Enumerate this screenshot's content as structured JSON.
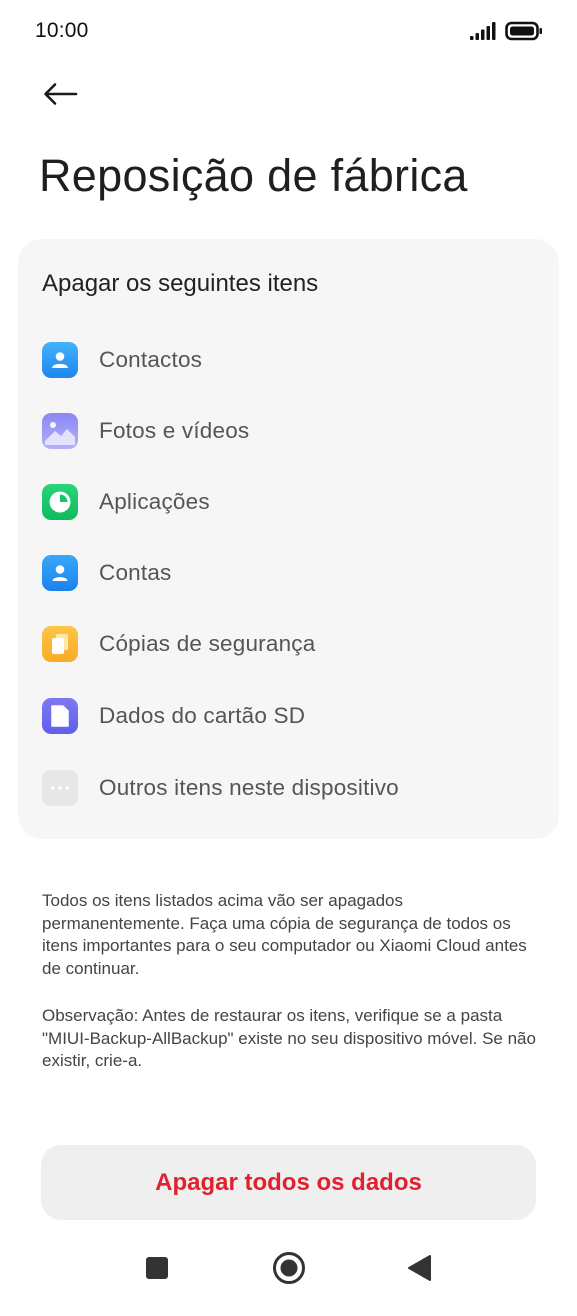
{
  "status_bar": {
    "time": "10:00",
    "signal_icon": "cellular-signal-icon",
    "battery_icon": "battery-full-icon"
  },
  "header": {
    "back_icon": "arrow-left-icon",
    "title": "Reposição de fábrica"
  },
  "card": {
    "title": "Apagar os seguintes itens",
    "items": [
      {
        "label": "Contactos",
        "icon": "contacts-icon",
        "color": "#2d9bf5"
      },
      {
        "label": "Fotos e vídeos",
        "icon": "gallery-icon",
        "color": "#7a7cf2"
      },
      {
        "label": "Aplicações",
        "icon": "apps-icon",
        "color": "#18c46a"
      },
      {
        "label": "Contas",
        "icon": "account-icon",
        "color": "#1e8ef0"
      },
      {
        "label": "Cópias de segurança",
        "icon": "backup-icon",
        "color": "#fbb936"
      },
      {
        "label": "Dados do cartão SD",
        "icon": "sd-card-icon",
        "color": "#6f6cf0"
      },
      {
        "label": "Outros itens neste dispositivo",
        "icon": "more-icon",
        "color": "#e6e6e6"
      }
    ]
  },
  "notices": {
    "warning": "Todos os itens listados acima vão ser apagados permanentemente. Faça uma cópia de segurança de todos os itens importantes para o seu computador ou Xiaomi Cloud antes de continuar.",
    "observation": "Observação: Antes de restaurar os itens, verifique se a pasta \"MIUI-Backup-AllBackup\" existe no seu dispositivo móvel. Se não existir, crie-a."
  },
  "actions": {
    "erase_label": "Apagar todos os dados",
    "erase_color": "#e0212e"
  },
  "nav_bar": {
    "recents_icon": "square-recents-icon",
    "home_icon": "circle-home-icon",
    "back_icon": "triangle-back-icon"
  }
}
